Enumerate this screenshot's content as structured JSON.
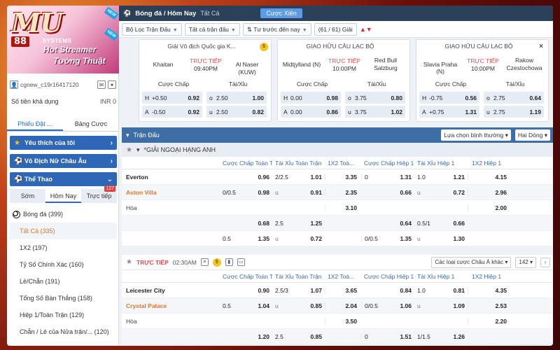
{
  "banner": {
    "logo_main": "MU",
    "logo_num": "88",
    "logo_suffix": ".SYSTEMS",
    "promo_line1": "Hot Streamer",
    "promo_line2": "Tường Thuật",
    "new_tag": "NEW"
  },
  "user": {
    "name": "cgnew_c19r16417120",
    "balance_label": "Số tiền khả dụng",
    "balance_value": "INR 0"
  },
  "left_tabs": [
    "Phiếu Đặt ...",
    "Bảng Cược"
  ],
  "nav_sections": [
    {
      "label": "Yêu thích của tôi",
      "icon": "star-icon"
    },
    {
      "label": "Vô Địch Nữ Châu Âu",
      "icon": "soccer-ball-icon"
    },
    {
      "label": "Thể Thao",
      "icon": "soccer-ball-icon"
    }
  ],
  "sport_tabs": [
    {
      "label": "Sớm"
    },
    {
      "label": "Hôm Nay",
      "active": true
    },
    {
      "label": "Trực tiếp",
      "badge": "127"
    }
  ],
  "sport_list": [
    {
      "label": "Bóng đá",
      "count": "(399)",
      "type": "sport"
    },
    {
      "label": "Tất Cả",
      "count": "(335)",
      "type": "sub",
      "selected": true
    },
    {
      "label": "1X2",
      "count": "(197)",
      "type": "sub"
    },
    {
      "label": "Tỷ Số Chính Xác",
      "count": "(160)",
      "type": "sub"
    },
    {
      "label": "Lẻ/Chẵn",
      "count": "(191)",
      "type": "sub"
    },
    {
      "label": "Tổng Số Bàn Thắng",
      "count": "(158)",
      "type": "sub"
    },
    {
      "label": "Hiệp 1/Toàn Trận",
      "count": "(129)",
      "type": "sub"
    },
    {
      "label": "Chẵn / Lẻ của Nửa trận/...",
      "count": "(120)",
      "type": "sub"
    }
  ],
  "topbar": {
    "title": "Bóng đá / Hôm Nay",
    "select": "Tất Cả",
    "button": "Cược Xiên"
  },
  "filters": {
    "f1": "Bộ Lọc Trận Đấu",
    "f2": "Tất cả trận đấu",
    "f3": "Tư trước đến nay",
    "count": "(61 / 61) Giải"
  },
  "cards": [
    {
      "competition": "Giải Vô địch Quốc gia K...",
      "home": "Khaitan",
      "away": "Al Naser (KUW)",
      "live": "TRỰC TIẾP",
      "time": "09:40PM",
      "hdp": [
        {
          "k": "H",
          "h": "+0.50",
          "o": "0.92"
        },
        {
          "k": "A",
          "h": "-0.50",
          "o": "0.92"
        }
      ],
      "ou": [
        {
          "k": "o",
          "h": "2.50",
          "o": "1.00"
        },
        {
          "k": "u",
          "h": "2.50",
          "o": "0.82"
        }
      ]
    },
    {
      "competition": "GIAO HỮU CÂU LẠC BỘ",
      "home": "Midtjylland (N)",
      "away": "Red Bull Salzburg",
      "live": "TRỰC TIẾP",
      "time": "10:00PM",
      "hdp": [
        {
          "k": "H",
          "h": "0.00",
          "o": "0.98"
        },
        {
          "k": "A",
          "h": "0.00",
          "o": "0.86"
        }
      ],
      "ou": [
        {
          "k": "o",
          "h": "3.75",
          "o": "0.80"
        },
        {
          "k": "u",
          "h": "3.75",
          "o": "1.02"
        }
      ]
    },
    {
      "competition": "GIAO HỮU CÂU LẠC BỘ",
      "home": "Slavia Praha (N)",
      "away": "Rakow Czestochowa",
      "live": "TRỰC TIẾP",
      "time": "10:00PM",
      "hdp": [
        {
          "k": "H",
          "h": "-0.75",
          "o": "0.56"
        },
        {
          "k": "A",
          "h": "+0.75",
          "o": "1.31"
        }
      ],
      "ou": [
        {
          "k": "o",
          "h": "2.75",
          "o": "0.64"
        },
        {
          "k": "u",
          "h": "2.75",
          "o": "1.19"
        }
      ]
    }
  ],
  "card_labels": {
    "hdp": "Cược Chấp",
    "ou": "Tài/Xỉu",
    "coin": "$"
  },
  "section": {
    "title": "Trận Đấu",
    "dd1": "Lựa chọn bình thường",
    "dd2": "Hai Dòng",
    "league": "*GIẢI NGOẠI HẠNG ANH"
  },
  "headers": {
    "hdp": "Cược Chấp Toàn T...",
    "ou": "Tài Xỉu Toàn Trận",
    "x12": "1X2 Toà...",
    "h1": "Cược Chấp Hiệp 1",
    "hou": "Tài Xỉu Hiệp 1",
    "h12": "1X2 Hiệp 1"
  },
  "match1": [
    {
      "team": "Everton",
      "cls": "home",
      "hdp_h": "",
      "hdp_o": "0.96",
      "ou_h": "2/2.5",
      "ou_o": "1.01",
      "x12": "3.35",
      "h1_h": "0",
      "h1_o": "1.31",
      "hou_h": "1.0",
      "hou_o": "1.21",
      "h12": "4.15"
    },
    {
      "team": "Aston Villa",
      "cls": "away",
      "hdp_h": "0/0.5",
      "hdp_o": "0.98",
      "ou_h": "u",
      "ou_o": "0.91",
      "x12": "2.35",
      "h1_h": "",
      "h1_o": "0.66",
      "hou_h": "u",
      "hou_o": "0.72",
      "h12": "2.96"
    },
    {
      "team": "Hòa",
      "cls": "draw",
      "hdp_h": "",
      "hdp_o": "",
      "ou_h": "",
      "ou_o": "",
      "x12": "3.10",
      "h1_h": "",
      "h1_o": "",
      "hou_h": "",
      "hou_o": "",
      "h12": "2.00"
    },
    {
      "team": "",
      "cls": "draw",
      "hdp_h": "",
      "hdp_o": "0.68",
      "ou_h": "2.5",
      "ou_o": "1.25",
      "x12": "",
      "h1_h": "",
      "h1_o": "0.64",
      "hou_h": "0.5/1",
      "hou_o": "0.66",
      "h12": ""
    },
    {
      "team": "",
      "cls": "draw",
      "hdp_h": "0.5",
      "hdp_o": "1.35",
      "ou_h": "u",
      "ou_o": "0.72",
      "x12": "",
      "h1_h": "0/0.5",
      "h1_o": "1.35",
      "hou_h": "u",
      "hou_o": "1.30",
      "h12": ""
    }
  ],
  "live_bar": {
    "live": "TRỰC TIẾP",
    "time": "02:30AM",
    "dd": "Các loại cược Châu Á khác",
    "num": "142"
  },
  "match2": [
    {
      "team": "Leicester City",
      "cls": "home",
      "hdp_h": "",
      "hdp_o": "0.90",
      "ou_h": "2.5/3",
      "ou_o": "1.07",
      "x12": "3.65",
      "h1_h": "",
      "h1_o": "0.84",
      "hou_h": "1.0",
      "hou_o": "0.81",
      "h12": "4.35"
    },
    {
      "team": "Crystal Palace",
      "cls": "away",
      "hdp_h": "0.5",
      "hdp_o": "1.04",
      "ou_h": "u",
      "ou_o": "0.85",
      "x12": "2.04",
      "h1_h": "0/0.5",
      "h1_o": "1.06",
      "hou_h": "u",
      "hou_o": "1.09",
      "h12": "2.53"
    },
    {
      "team": "Hòa",
      "cls": "draw",
      "hdp_h": "",
      "hdp_o": "",
      "ou_h": "",
      "ou_o": "",
      "x12": "3.50",
      "h1_h": "",
      "h1_o": "",
      "hou_h": "",
      "hou_o": "",
      "h12": "2.20"
    },
    {
      "team": "",
      "cls": "draw",
      "hdp_h": "",
      "hdp_o": "1.20",
      "ou_h": "2.5",
      "ou_o": "0.85",
      "x12": "",
      "h1_h": "0",
      "h1_o": "1.51",
      "hou_h": "1/1.5",
      "hou_o": "1.26",
      "h12": ""
    }
  ]
}
